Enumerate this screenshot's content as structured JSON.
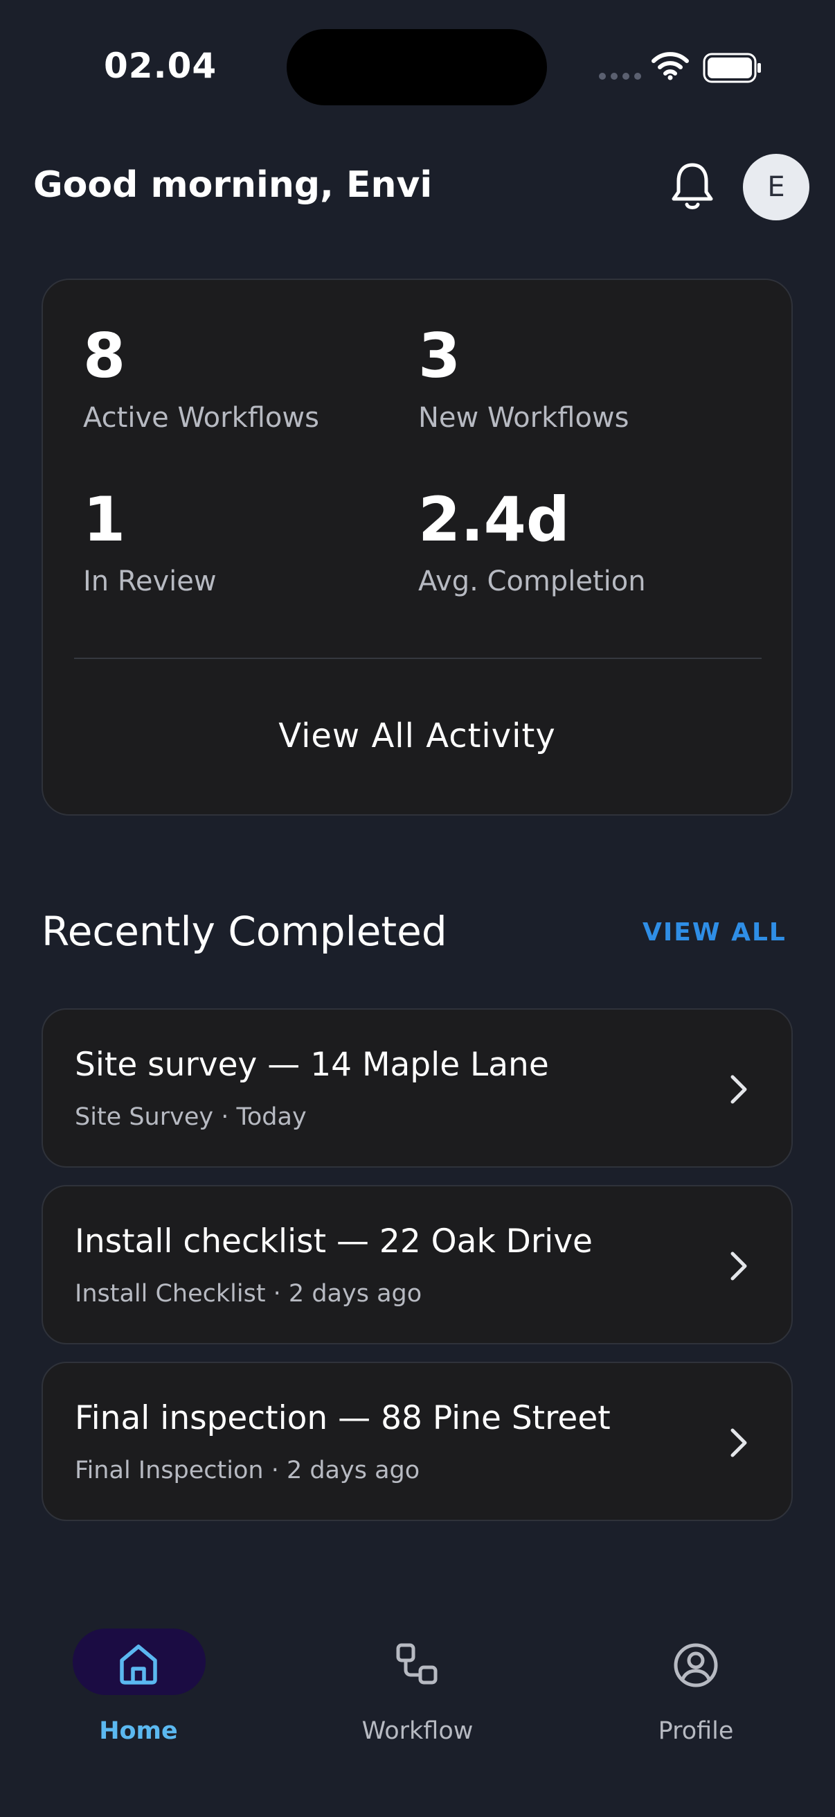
{
  "status_bar": {
    "time": "02.04",
    "icons": [
      "signal-dots-icon",
      "wifi-icon",
      "battery-icon"
    ]
  },
  "header": {
    "greeting": "Good morning, Envi",
    "avatar_initial": "E",
    "icons": [
      "bell-icon"
    ]
  },
  "stats": [
    {
      "value": "8",
      "label": "Active Workflows"
    },
    {
      "value": "3",
      "label": "New Workflows"
    },
    {
      "value": "1",
      "label": "In Review"
    },
    {
      "value": "2.4d",
      "label": "Avg. Completion"
    }
  ],
  "stats_card": {
    "action_label": "View All Activity"
  },
  "recently_completed": {
    "title": "Recently Completed",
    "view_all_label": "VIEW ALL",
    "items": [
      {
        "title": "Site survey — 14 Maple Lane",
        "meta": "Site Survey · Today"
      },
      {
        "title": "Install checklist — 22 Oak Drive",
        "meta": "Install Checklist · 2 days ago"
      },
      {
        "title": "Final inspection — 88 Pine Street",
        "meta": "Final Inspection · 2 days ago"
      }
    ]
  },
  "bottom_nav": {
    "items": [
      {
        "label": "Home",
        "icon": "home-icon",
        "active": true
      },
      {
        "label": "Workflow",
        "icon": "workflow-icon",
        "active": false
      },
      {
        "label": "Profile",
        "icon": "profile-icon",
        "active": false
      }
    ]
  },
  "colors": {
    "background": "#1b1f2a",
    "card": "#1c1c1e",
    "accent_link": "#2f8ee6",
    "nav_active_text": "#5bb8f0",
    "nav_active_pill": "#1b0c43"
  }
}
